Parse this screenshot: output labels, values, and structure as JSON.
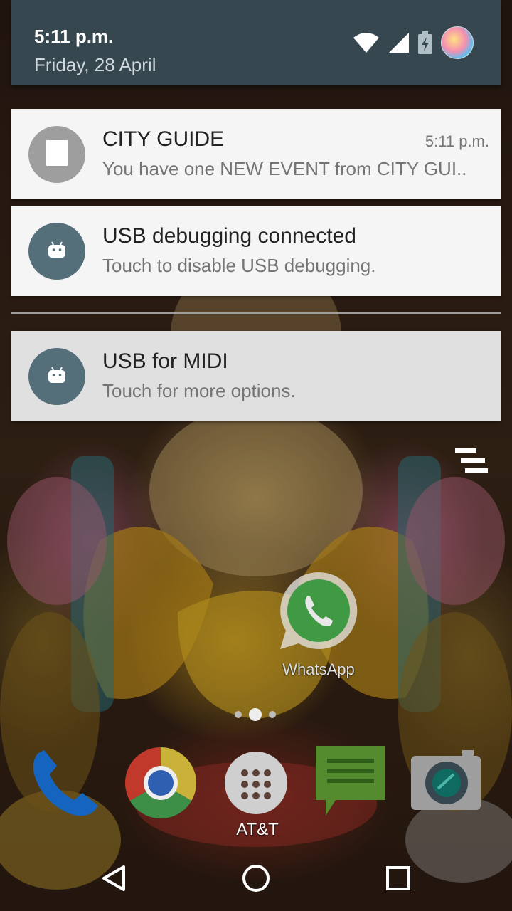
{
  "status_bar": {
    "time": "5:11 p.m.",
    "date": "Friday, 28 April",
    "icons": [
      "wifi-icon",
      "signal-icon",
      "battery-charging-icon",
      "avatar"
    ]
  },
  "notifications": [
    {
      "id": "city-guide",
      "icon": "stop-square-icon",
      "title": "CITY GUIDE",
      "text": "You have one NEW EVENT from CITY GUI..",
      "time": "5:11 p.m."
    },
    {
      "id": "usb-debugging",
      "icon": "android-icon",
      "title": "USB debugging connected",
      "text": "Touch to disable USB debugging."
    },
    {
      "id": "usb-midi",
      "icon": "android-icon",
      "title": "USB for MIDI",
      "text": "Touch for more options."
    }
  ],
  "home": {
    "apps": [
      {
        "label": "WhatsApp",
        "icon": "whatsapp-icon"
      }
    ],
    "page_count": 3,
    "current_page": 2,
    "dock": [
      "phone-icon",
      "chrome-icon",
      "app-drawer-icon",
      "messaging-icon",
      "camera-icon"
    ],
    "carrier": "AT&T"
  },
  "navigation": [
    "back-icon",
    "home-icon",
    "recents-icon"
  ],
  "colors": {
    "header": "#37474f",
    "card": "#f5f5f5",
    "android_circle": "#546e7a",
    "city_circle": "#9e9e9e"
  }
}
